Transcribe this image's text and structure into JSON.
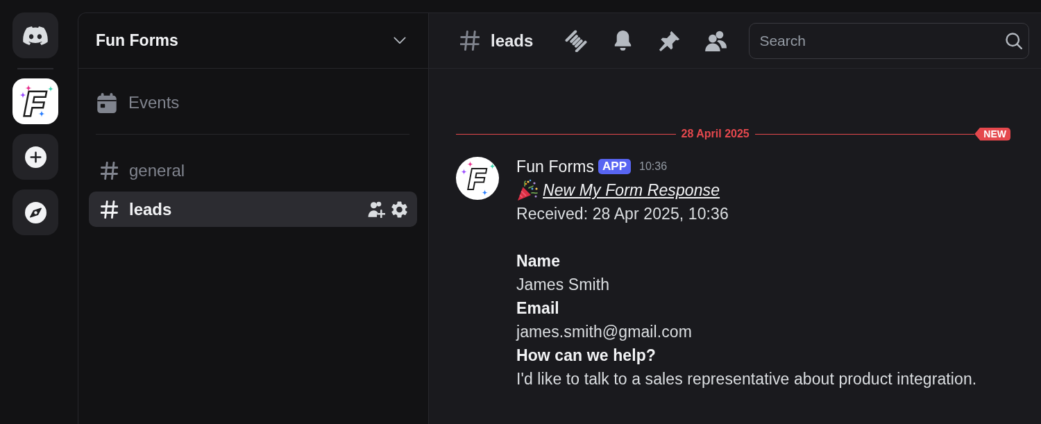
{
  "rail": {
    "server_logo": "F"
  },
  "sidebar": {
    "server_name": "Fun Forms",
    "events": {
      "label": "Events"
    },
    "channels": [
      {
        "name": "general",
        "selected": false
      },
      {
        "name": "leads",
        "selected": true
      }
    ]
  },
  "channel_header": {
    "name": "leads",
    "search": {
      "placeholder": "Search"
    }
  },
  "chat": {
    "date_divider": {
      "label": "28 April 2025",
      "badge": "NEW"
    },
    "message": {
      "avatar_logo": "F",
      "author": "Fun Forms",
      "tag": "APP",
      "time": "10:36",
      "title": "New My Form Response",
      "received": "Received: 28 Apr 2025, 10:36",
      "fields": [
        {
          "label": "Name",
          "value": "James Smith"
        },
        {
          "label": "Email",
          "value": "james.smith@gmail.com"
        },
        {
          "label": "How can we help?",
          "value": "I'd like to talk to a sales representative about product integration."
        }
      ]
    }
  }
}
